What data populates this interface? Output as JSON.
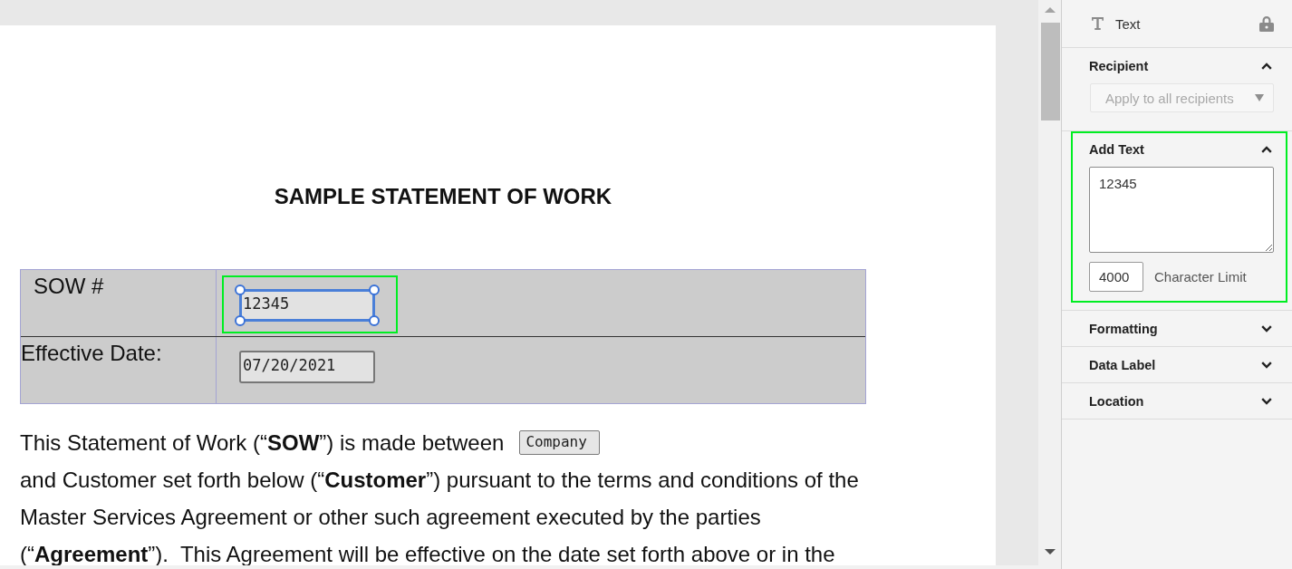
{
  "document": {
    "title": "SAMPLE STATEMENT OF WORK",
    "table": {
      "rows": [
        {
          "label": "SOW #",
          "field": {
            "value": "12345",
            "selected": true,
            "highlighted": true
          }
        },
        {
          "label": "Effective Date:",
          "field": {
            "value": "07/20/2021",
            "selected": false,
            "highlighted": false
          }
        }
      ]
    },
    "paragraph": {
      "lead": "This Statement of Work (“**SOW**”) is made between",
      "field": {
        "value": "Company"
      },
      "lines": [
        "and Customer set forth below (“**Customer**”) pursuant to the terms and conditions of the",
        "Master Services Agreement or other such agreement executed by the parties",
        "(“**Agreement**”).  This Agreement will be effective on the date set forth above or in the"
      ]
    }
  },
  "panel": {
    "header": {
      "title": "Text",
      "locked": true
    },
    "sections": [
      {
        "kind": "recipient",
        "title": "Recipient",
        "expanded": true,
        "highlighted": false,
        "dropdown": {
          "placeholder": "Apply to all recipients"
        }
      },
      {
        "kind": "add_text",
        "title": "Add Text",
        "expanded": true,
        "highlighted": true,
        "text": "12345",
        "limit": "4000",
        "limit_label": "Character Limit"
      },
      {
        "kind": "group",
        "title": "Formatting",
        "expanded": false,
        "highlighted": false
      },
      {
        "kind": "group",
        "title": "Data Label",
        "expanded": false,
        "highlighted": false
      },
      {
        "kind": "group",
        "title": "Location",
        "expanded": false,
        "highlighted": false
      }
    ]
  }
}
